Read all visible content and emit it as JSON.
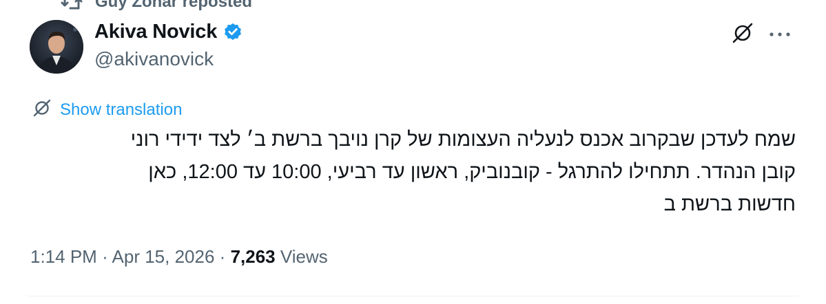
{
  "repost": {
    "label": "Guy Zohar reposted",
    "icon": "repost-icon"
  },
  "author": {
    "name": "Akiva Novick",
    "handle": "@akivanovick",
    "verified": true,
    "verified_color": "#1d9bf0",
    "avatar_icon": "avatar"
  },
  "actions": {
    "grok_icon": "grok-icon",
    "more_icon": "more-icon"
  },
  "translation": {
    "icon": "translate-icon",
    "label": "Show translation"
  },
  "tweet": {
    "lines": [
      "שמח לעדכן שבקרוב אכנס לנעליה העצומות של קרן נויבך ברשת ב׳ לצד ידידי רוני",
      "קובן הנהדר. תתחילו להתרגל - קובנוביק, ראשון עד רביעי, 10:00 עד 12:00, כאן",
      "חדשות ברשת ב"
    ]
  },
  "meta": {
    "time": "1:14 PM",
    "separator": "·",
    "date": "Apr 15, 2026",
    "views_count": "7,263",
    "views_label": "Views"
  },
  "colors": {
    "link": "#1d9bf0",
    "secondary": "#536471",
    "primary": "#0f1419"
  }
}
